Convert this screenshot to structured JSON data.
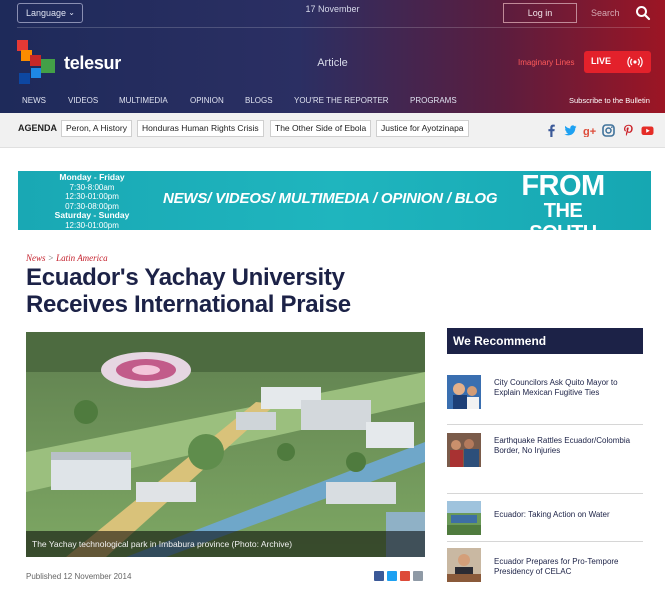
{
  "header": {
    "language_label": "Language",
    "date": "17 November",
    "login_label": "Log in",
    "search_placeholder": "Search",
    "logo_text": "telesur",
    "section_label": "Article",
    "imaginary_lines": "Imaginary Lines",
    "live_label": "LIVE",
    "subscribe": "Subscribe to the Bulletin",
    "nav": [
      "NEWS",
      "VIDEOS",
      "MULTIMEDIA",
      "OPINION",
      "BLOGS",
      "YOU'RE THE REPORTER",
      "PROGRAMS"
    ]
  },
  "agenda": {
    "label": "AGENDA",
    "tags": [
      "Peron, A History",
      "Honduras Human Rights Crisis",
      "The Other Side of Ebola",
      "Justice for Ayotzinapa"
    ],
    "social_icons": [
      "facebook-icon",
      "twitter-icon",
      "google-plus-icon",
      "instagram-icon",
      "pinterest-icon",
      "youtube-icon"
    ],
    "social_colors": [
      "#3b5998",
      "#1da1f2",
      "#dd4b39",
      "#3f729b",
      "#cb2027",
      "#e52d27"
    ]
  },
  "banner": {
    "schedule": [
      "Monday - Friday",
      "7:30-8:00am",
      "12:30-01:00pm",
      "07:30-08:00pm",
      "Saturday - Sunday",
      "12:30-01:00pm"
    ],
    "categories": "NEWS/ VIDEOS/ MULTIMEDIA / OPINION / BLOG",
    "tagline_top": "FROM",
    "tagline_bottom": "THE SOUTH"
  },
  "article": {
    "crumb_section": "News",
    "crumb_sep": ">",
    "crumb_sub": "Latin America",
    "title": "Ecuador's Yachay University Receives International Praise",
    "caption": "The Yachay technological park in Imbabura province (Photo: Archive)",
    "published": "Published 12 November 2014"
  },
  "sidebar": {
    "heading": "We Recommend",
    "items": [
      {
        "text": "City Councilors Ask Quito Mayor to Explain Mexican Fugitive Ties"
      },
      {
        "text": "Earthquake Rattles Ecuador/Colombia Border, No Injuries"
      },
      {
        "text": "Ecuador: Taking Action on Water"
      },
      {
        "text": "Ecuador Prepares for Pro-Tempore Presidency of CELAC"
      }
    ]
  },
  "colors": {
    "brand_navy": "#1c2247",
    "live_red": "#e3212b",
    "banner_teal": "#1fb5be"
  }
}
